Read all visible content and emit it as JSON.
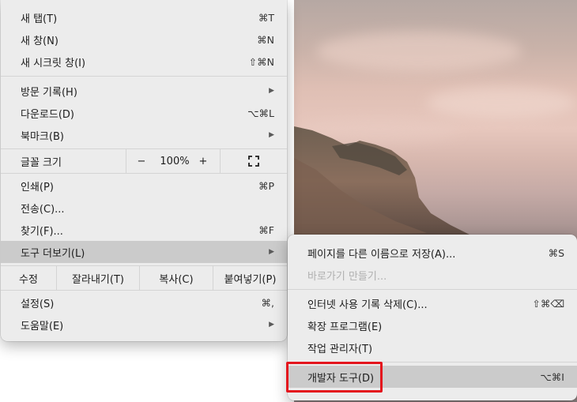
{
  "main_menu": {
    "items_group1": [
      {
        "label": "새 탭(T)",
        "shortcut": "⌘T"
      },
      {
        "label": "새 창(N)",
        "shortcut": "⌘N"
      },
      {
        "label": "새 시크릿 창(I)",
        "shortcut": "⇧⌘N"
      }
    ],
    "items_group2": [
      {
        "label": "방문 기록(H)",
        "arrow": "▶"
      },
      {
        "label": "다운로드(D)",
        "shortcut": "⌥⌘L"
      },
      {
        "label": "북마크(B)",
        "arrow": "▶"
      }
    ],
    "font_size": {
      "label": "글꼴 크기",
      "minus": "−",
      "value": "100%",
      "plus": "+"
    },
    "items_group3": [
      {
        "label": "인쇄(P)",
        "shortcut": "⌘P"
      },
      {
        "label": "전송(C)...",
        "shortcut": ""
      },
      {
        "label": "찾기(F)...",
        "shortcut": "⌘F"
      },
      {
        "label": "도구 더보기(L)",
        "arrow": "▶"
      }
    ],
    "edit": {
      "label": "수정",
      "cut": "잘라내기(T)",
      "copy": "복사(C)",
      "paste": "붙여넣기(P)"
    },
    "items_group4": [
      {
        "label": "설정(S)",
        "shortcut": "⌘,"
      },
      {
        "label": "도움말(E)",
        "arrow": "▶"
      }
    ]
  },
  "submenu": {
    "items_group1": [
      {
        "label": "페이지를 다른 이름으로 저장(A)...",
        "shortcut": "⌘S"
      },
      {
        "label": "바로가기 만들기...",
        "shortcut": ""
      }
    ],
    "items_group2": [
      {
        "label": "인터넷 사용 기록 삭제(C)...",
        "shortcut": "⇧⌘⌫"
      },
      {
        "label": "확장 프로그램(E)",
        "shortcut": ""
      },
      {
        "label": "작업 관리자(T)",
        "shortcut": ""
      }
    ],
    "items_group3": [
      {
        "label": "개발자 도구(D)",
        "shortcut": "⌥⌘I"
      }
    ]
  },
  "colors": {
    "highlight": "#cbcbcb",
    "annotation_box": "#e4151d"
  }
}
